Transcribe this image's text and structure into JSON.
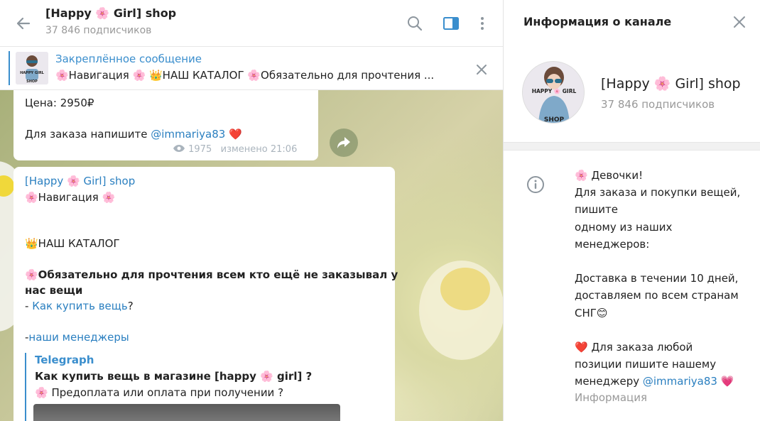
{
  "header": {
    "title": "[Happy 🌸 Girl] shop",
    "subscribers": "37 846 подписчиков"
  },
  "pinned": {
    "title": "Закреплённое сообщение",
    "text": "🌸Навигация 🌸  👑НАШ КАТАЛОГ  🌸Обязательно для прочтения ..."
  },
  "message1": {
    "price": "Цена:  2950₽",
    "order_prefix": "Для заказа напишите ",
    "order_handle": "@immariya83",
    "order_emoji": "❤️",
    "views": "1975",
    "edited": "изменено 21:06"
  },
  "message2": {
    "author": "[Happy 🌸 Girl] shop",
    "nav": "🌸Навигация 🌸",
    "catalog": "👑НАШ КАТАЛОГ",
    "must_read_1": "🌸Обязательно для прочтения всем кто ещё не заказывал у",
    "must_read_2": "нас вещи",
    "how_prefix": "- ",
    "how_link": "Как купить вещь",
    "how_suffix": "?",
    "managers_prefix": "-",
    "managers_link": "наши менеджеры",
    "preview_site": "Telegraph",
    "preview_title": "Как купить вещь в магазине [happy 🌸 girl] ?",
    "preview_desc": "🌸 Предоплата или оплата при получении ?"
  },
  "info_panel": {
    "heading": "Информация о канале",
    "title": "[Happy 🌸 Girl] shop",
    "subscribers": "37 846 подписчиков",
    "description_lines": [
      "🌸 Девочки!",
      "Для заказа и покупки вещей,",
      "пишите",
      "одному из наших",
      "менеджеров:",
      "",
      "Доставка в течении 10 дней,",
      "доставляем по всем странам",
      "СНГ😊",
      "",
      "❤️ Для заказа любой",
      "позиции пишите нашему"
    ],
    "last_line_prefix": "менеджеру ",
    "last_line_handle": "@immariya83",
    "last_line_emoji": " 💗",
    "label": "Информация"
  },
  "avatar_text": {
    "line1": "HAPPY 🌸 GIRL",
    "line2": "SHOP"
  },
  "colors": {
    "accent": "#3a8ecd",
    "link": "#2a7fc0",
    "muted": "#999999"
  },
  "icons": [
    "back-arrow-icon",
    "search-icon",
    "sidebar-toggle-icon",
    "more-vertical-icon",
    "close-icon",
    "share-icon",
    "eye-icon",
    "info-icon"
  ]
}
